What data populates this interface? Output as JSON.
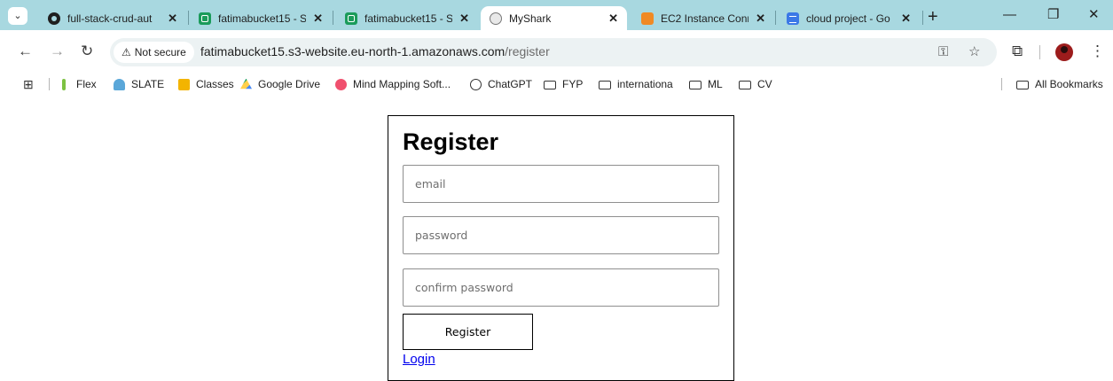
{
  "browser": {
    "tabs": [
      {
        "title": "full-stack-crud-aut",
        "favicon": "github-icon",
        "active": false
      },
      {
        "title": "fatimabucket15 - S",
        "favicon": "s3-bucket-icon",
        "active": false
      },
      {
        "title": "fatimabucket15 - S",
        "favicon": "s3-bucket-icon",
        "active": false
      },
      {
        "title": "MyShark",
        "favicon": "globe-icon",
        "active": true
      },
      {
        "title": "EC2 Instance Conn",
        "favicon": "ec2-icon",
        "active": false
      },
      {
        "title": "cloud project - Go",
        "favicon": "google-docs-icon",
        "active": false
      }
    ],
    "tab_close": "✕",
    "new_tab": "+",
    "window_controls": {
      "minimize": "—",
      "restore": "❐",
      "close": "✕"
    },
    "security_label": "Not secure",
    "url_host": "fatimabucket15.s3-website.eu-north-1.amazonaws.com",
    "url_path": "/register",
    "bookmarks": [
      {
        "label": "Flex",
        "icon": "flex-icon"
      },
      {
        "label": "SLATE",
        "icon": "slate-icon"
      },
      {
        "label": "Classes",
        "icon": "classes-icon"
      },
      {
        "label": "Google Drive",
        "icon": "google-drive-icon"
      },
      {
        "label": "Mind Mapping Soft...",
        "icon": "mind-mapping-icon"
      },
      {
        "label": "ChatGPT",
        "icon": "chatgpt-icon"
      },
      {
        "label": "FYP",
        "icon": "folder-icon"
      },
      {
        "label": "internationa",
        "icon": "folder-icon"
      },
      {
        "label": "ML",
        "icon": "folder-icon"
      },
      {
        "label": "CV",
        "icon": "folder-icon"
      }
    ],
    "all_bookmarks": "All Bookmarks",
    "colors": {
      "tabstrip": "#a8d8e0",
      "omnibox": "#ecf2f3"
    }
  },
  "form": {
    "title": "Register",
    "email_placeholder": "email",
    "password_placeholder": "password",
    "confirm_placeholder": "confirm password",
    "submit_label": "Register",
    "login_link": "Login"
  }
}
